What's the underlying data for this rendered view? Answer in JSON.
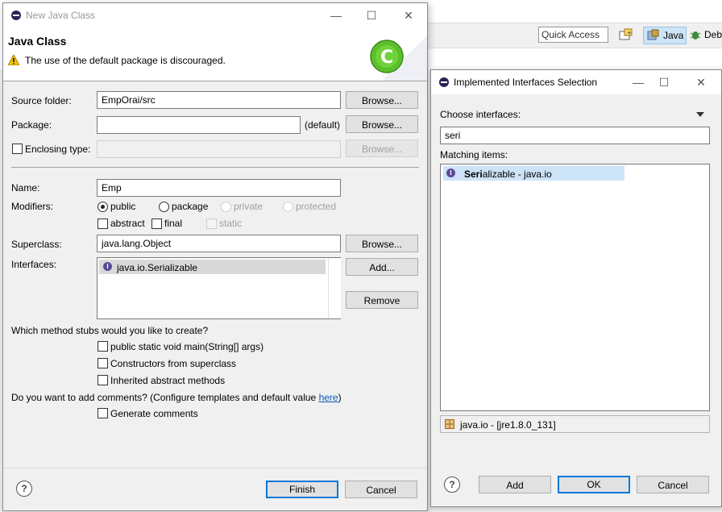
{
  "background": {
    "quick_access": "Quick Access",
    "perspectives": [
      {
        "label": "Java",
        "active": true
      },
      {
        "label": "Deb",
        "active": false
      }
    ]
  },
  "new_class_dialog": {
    "title": "New Java Class",
    "heading": "Java Class",
    "warning": "The use of the default package is discouraged.",
    "source_folder": {
      "label": "Source folder:",
      "value": "EmpOrai/src",
      "browse": "Browse..."
    },
    "package": {
      "label": "Package:",
      "value": "",
      "default_hint": "(default)",
      "browse": "Browse..."
    },
    "enclosing": {
      "label": "Enclosing type:",
      "checked": false,
      "value": "",
      "browse": "Browse..."
    },
    "name": {
      "label": "Name:",
      "value": "Emp"
    },
    "modifiers": {
      "label": "Modifiers:",
      "radios": [
        {
          "label": "public",
          "checked": true,
          "enabled": true
        },
        {
          "label": "package",
          "checked": false,
          "enabled": true
        },
        {
          "label": "private",
          "checked": false,
          "enabled": false
        },
        {
          "label": "protected",
          "checked": false,
          "enabled": false
        }
      ],
      "checks": [
        {
          "label": "abstract",
          "checked": false,
          "enabled": true
        },
        {
          "label": "final",
          "checked": false,
          "enabled": true
        },
        {
          "label": "static",
          "checked": false,
          "enabled": false
        }
      ]
    },
    "superclass": {
      "label": "Superclass:",
      "value": "java.lang.Object",
      "browse": "Browse..."
    },
    "interfaces": {
      "label": "Interfaces:",
      "items": [
        "java.io.Serializable"
      ],
      "add": "Add...",
      "remove": "Remove"
    },
    "stubs": {
      "question": "Which method stubs would you like to create?",
      "options": [
        {
          "label": "public static void main(String[] args)",
          "checked": false
        },
        {
          "label": "Constructors from superclass",
          "checked": false
        },
        {
          "label": "Inherited abstract methods",
          "checked": false
        }
      ]
    },
    "comments": {
      "question": "Do you want to add comments? (Configure templates and default value ",
      "link": "here",
      "close_paren": ")",
      "option": {
        "label": "Generate comments",
        "checked": false
      }
    },
    "finish": "Finish",
    "cancel": "Cancel"
  },
  "iface_dialog": {
    "title": "Implemented Interfaces Selection",
    "choose_label": "Choose interfaces:",
    "filter_value": "seri",
    "matching_label": "Matching items:",
    "items": [
      {
        "match": "Seri",
        "rest": "alizable - java.io",
        "selected": true
      }
    ],
    "status": "java.io - [jre1.8.0_131]",
    "add": "Add",
    "ok": "OK",
    "cancel": "Cancel"
  },
  "colors": {
    "accent": "#0078d7",
    "selection": "#cde3f7",
    "warning": "#f2c200",
    "class_icon_green": "#5bbf2a"
  }
}
